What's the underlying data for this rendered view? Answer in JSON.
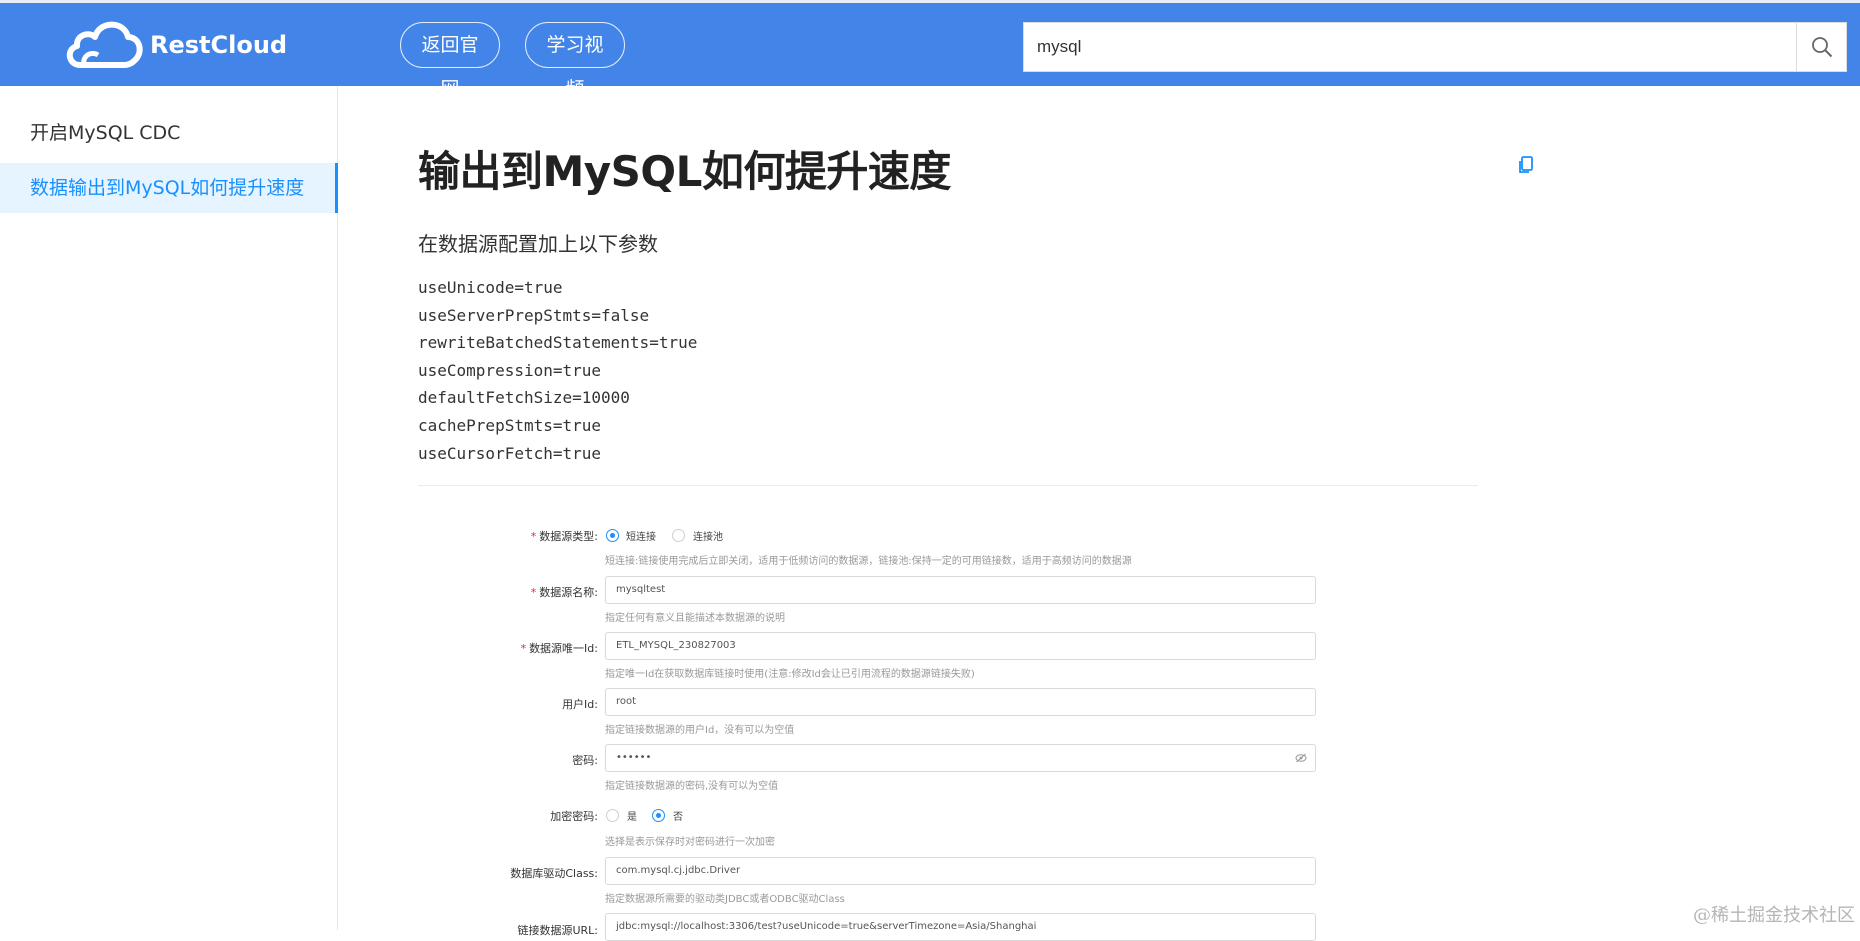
{
  "header": {
    "brand": "RestCloud",
    "nav": [
      "返回官网",
      "学习视频"
    ],
    "search": {
      "value": "mysql"
    }
  },
  "sidebar": {
    "items": [
      {
        "label": "开启MySQL CDC"
      },
      {
        "label": "数据输出到MySQL如何提升速度"
      }
    ]
  },
  "main": {
    "title": "输出到MySQL如何提升速度",
    "subtitle": "在数据源配置加上以下参数",
    "code_lines": [
      "useUnicode=true",
      "useServerPrepStmts=false",
      "rewriteBatchedStatements=true",
      "useCompression=true",
      "defaultFetchSize=10000",
      "cachePrepStmts=true",
      "useCursorFetch=true"
    ]
  },
  "form": {
    "ds_type": {
      "label": "数据源类型:",
      "options": [
        "短连接",
        "连接池"
      ],
      "help": "短连接:链接使用完成后立即关闭，适用于低频访问的数据源，链接池:保持一定的可用链接数，适用于高频访问的数据源"
    },
    "ds_name": {
      "label": "数据源名称:",
      "value": "mysqltest",
      "help": "指定任何有意义且能描述本数据源的说明"
    },
    "ds_id": {
      "label": "数据源唯一Id:",
      "value": "ETL_MYSQL_230827003",
      "help": "指定唯一Id在获取数据库链接时使用(注意:修改Id会让已引用流程的数据源链接失败)"
    },
    "user_id": {
      "label": "用户Id:",
      "value": "root",
      "help": "指定链接数据源的用户Id，没有可以为空值"
    },
    "password": {
      "label": "密码:",
      "value": "••••••",
      "help": "指定链接数据源的密码,没有可以为空值"
    },
    "encrypt": {
      "label": "加密密码:",
      "options": [
        "是",
        "否"
      ],
      "help": "选择是表示保存时对密码进行一次加密"
    },
    "driver": {
      "label": "数据库驱动Class:",
      "value": "com.mysql.cj.jdbc.Driver",
      "help": "指定数据源所需要的驱动类JDBC或者ODBC驱动Class"
    },
    "url": {
      "label": "链接数据源URL:",
      "value": "jdbc:mysql://localhost:3306/test?useUnicode=true&serverTimezone=Asia/Shanghai"
    }
  },
  "watermark": "@稀土掘金技术社区",
  "colors": {
    "header_bg": "#4284e8",
    "accent": "#1890ff",
    "active_bg": "#e6f4ff"
  }
}
